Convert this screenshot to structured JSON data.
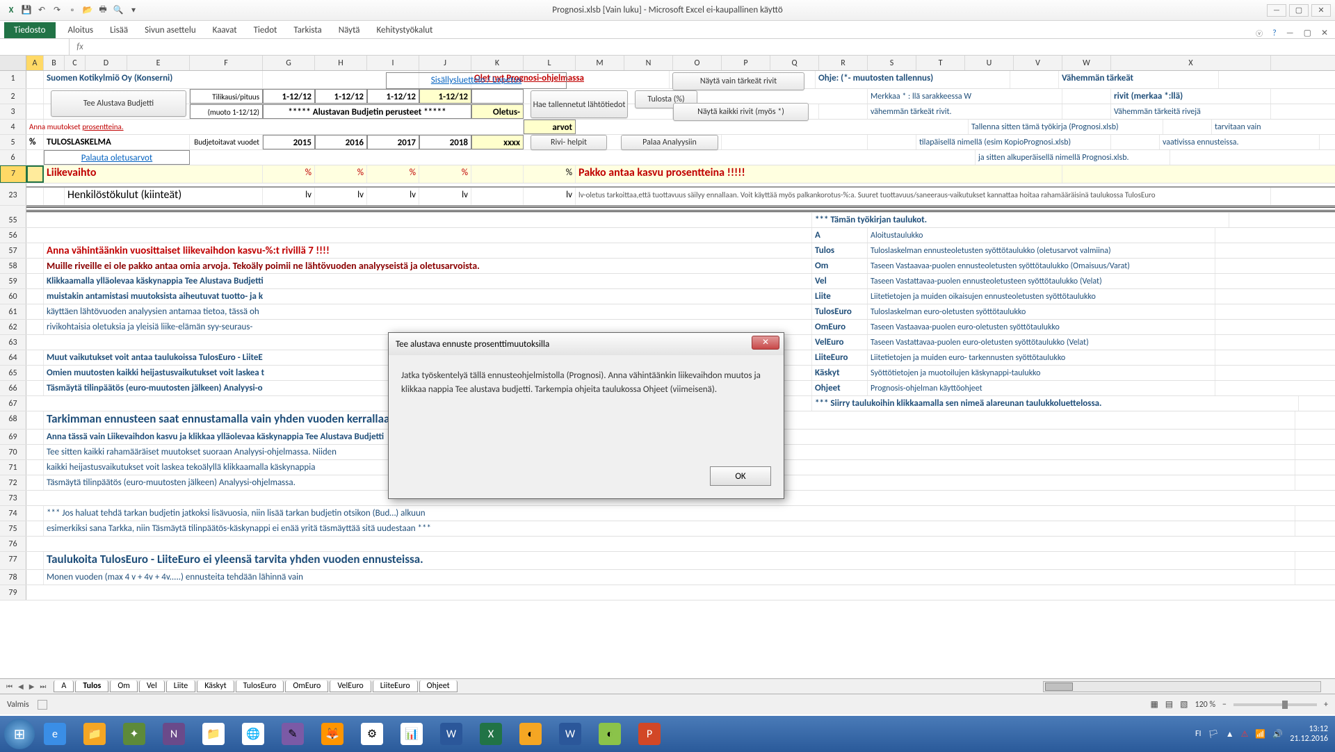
{
  "title": "Prognosi.xlsb  [Vain luku] - Microsoft Excel ei-kaupallinen käyttö",
  "ribbon": {
    "file": "Tiedosto",
    "tabs": [
      "Aloitus",
      "Lisää",
      "Sivun asettelu",
      "Kaavat",
      "Tiedot",
      "Tarkista",
      "Näytä",
      "Kehitystyökalut"
    ]
  },
  "columns": [
    "A",
    "B",
    "C",
    "D",
    "E",
    "F",
    "G",
    "H",
    "I",
    "J",
    "K",
    "L",
    "M",
    "N",
    "O",
    "P",
    "Q",
    "R",
    "S",
    "T",
    "U",
    "V",
    "W",
    "X"
  ],
  "rows_visible": [
    "1",
    "2",
    "3",
    "4",
    "5",
    "6",
    "7",
    "23",
    "55",
    "56",
    "57",
    "58",
    "59",
    "60",
    "61",
    "62",
    "63",
    "64",
    "65",
    "66",
    "67",
    "68",
    "69",
    "70",
    "71",
    "72",
    "73",
    "74",
    "75",
    "76",
    "77",
    "78",
    "79"
  ],
  "content": {
    "r1_company": "Suomen Kotikylmiö Oy (Konserni)",
    "r1_link": "Sisällysluettelo / Lopetus",
    "r1_red": "Olet nyt Prognosi-ohjelmassa",
    "btn_tarkeat": "Näytä vain tärkeät rivit",
    "r1_ohje": "Ohje: (*- muutosten tallennus)",
    "r1_vah": "Vähemmän tärkeät",
    "btn_tee": "Tee Alustava Budjetti",
    "r2_f": "Tilikausi/pituus",
    "r2_dates": [
      "1-12/12",
      "1-12/12",
      "1-12/12",
      "1-12/12"
    ],
    "btn_hae": "Hae tallennetut lähtötiedot",
    "btn_tulosta": "Tulosta (%)",
    "r2_s": "Merkkaa * : llä sarakkeessa W",
    "r2_x": "rivit (merkaa *:llä)",
    "r3_f": "(muoto 1-12/12)",
    "r3_g": "***** Alustavan Budjetin perusteet *****",
    "r3_k": "Oletus-",
    "btn_kaikki": "Näytä kaikki rivit (myös *)",
    "r3_s": "vähemmän tärkeät rivit.",
    "r3_x": "Vähemmän tärkeitä rivejä",
    "r4_a": "Anna muutokset ",
    "r4_a2": "prosentteina.",
    "r4_k": "arvot",
    "r4_s": "Tallenna sitten tämä työkirja (Prognosi.xlsb)",
    "r4_x": "tarvitaan vain",
    "r5_a": "%",
    "r5_b": "TULOSLASKELMA",
    "r5_f": "Budjetoitavat vuodet",
    "r5_years": [
      "2015",
      "2016",
      "2017",
      "2018"
    ],
    "r5_k": "xxxx",
    "btn_rivi": "Rivi- helpit",
    "btn_palaa": "Palaa Analyysiin",
    "r5_s": "tilapäisellä nimellä (esim KopioPrognosi.xlsb)",
    "r5_x": "vaativissa ennusteissa.",
    "r6_link": "Palauta oletusarvot",
    "r6_s": "ja sitten alkuperäisellä nimellä Prognosi.xlsb.",
    "r7_b": "Liikevaihto",
    "r7_pct": "%",
    "r7_l": "% ",
    "r7_red": "Pakko antaa kasvu prosentteina !!!!!",
    "r23_b": "Henkilöstökulut (kiinteät)",
    "r23_lv": "lv",
    "r23_note": "lv-oletus tarkoittaa,että tuottavuus säilyy ennallaan. Voit käyttää myös palkankorotus-%:a. Suuret tuottavuus/saneeraus-vaikutukset kannattaa hoitaa rahamääräisinä taulukossa TulosEuro",
    "r55_p": "*** Tämän työkirjan taulukot.",
    "r56_p": "A",
    "r56_r": "Aloitustaulukko",
    "r57_a": "Anna vähintäänkin vuosittaiset liikevaihdon kasvu-%:t rivillä 7 !!!!",
    "r57_p": "Tulos",
    "r57_r": "Tuloslaskelman ennusteoletusten syöttötaulukko (oletusarvot valmiina)",
    "r58_a": "Muille riveille ei ole pakko antaa omia arvoja. Tekoäly poimii ne lähtövuoden analyyseistä ja oletusarvoista.",
    "r58_p": "Om",
    "r58_r": "Taseen Vastaavaa-puolen ennusteoletusten syöttötaulukko (Omaisuus/Varat)",
    "r59_a": "Klikkaamalla ylläolevaa käskynappia Tee Alustava Budjetti",
    "r59_p": "Vel",
    "r59_r": "Taseen Vastattavaa-puolen ennusteoletusteen syöttötaulukko (Velat)",
    "r60_a": "muistakin antamistasi muutoksista aiheutuvat tuotto- ja k",
    "r60_p": "Liite",
    "r60_r": "Liitetietojen ja muiden oikaisujen ennusteoletusten syöttötaulukko",
    "r61_a": "käyttäen lähtövuoden analyysien antamaa tietoa, tässä oh",
    "r61_p": "TulosEuro",
    "r61_r": "Tuloslaskelman euro-oletusten syöttötaulukko",
    "r62_a": "rivikohtaisia oletuksia ja yleisiä liike-elämän syy-seuraus-",
    "r62_p": "OmEuro",
    "r62_r": "Taseen Vastaavaa-puolen euro-oletusten syöttötaulukko",
    "r63_p": "VelEuro",
    "r63_r": "Taseen Vastattavaa-puolen euro-oletusten syöttötaulukko (Velat)",
    "r64_a": "Muut vaikutukset voit antaa taulukoissa TulosEuro - LiiteE",
    "r64_p": "LiiteEuro",
    "r64_r": "Liitetietojen ja muiden euro- tarkennusten syöttötaulukko",
    "r65_a": "Omien muutosten kaikki heijastusvaikutukset voit laskea t",
    "r65_p": "Käskyt",
    "r65_r": "Syöttötietojen ja muotoilujen käskynappi-taulukko",
    "r66_a": "Täsmäytä tilinpäätös (euro-muutosten jälkeen) Analyysi-o",
    "r66_p": "Ohjeet",
    "r66_r": "Prognosis-ohjelman käyttöohjeet",
    "r67_p": "*** Siirry taulukoihin klikkaamalla sen nimeä alareunan taulukkoluettelossa.",
    "r68_a": "Tarkimman ennusteen saat ennustamalla vain yhden vuoden kerrallaan.",
    "r69_a": "Anna tässä vain Liikevaihdon kasvu ja klikkaa ylläolevaa käskynappia Tee Alustava Budjetti",
    "r70_a": "Tee sitten kaikki rahamääräiset muutokset suoraan Analyysi-ohjelmassa. Niiden",
    "r71_a": "kaikki heijastusvaikutukset voit laskea tekoälyllä klikkaamalla käskynappia",
    "r72_a": "Täsmäytä tilinpäätös (euro-muutosten jälkeen) Analyysi-ohjelmassa.",
    "r74_a": "*** Jos haluat tehdä tarkan budjetin jatkoksi lisävuosia, niin lisää tarkan budjetin otsikon (Bud…) alkuun",
    "r75_a": "esimerkiksi sana Tarkka, niin Täsmäytä tilinpäätös-käskynappi ei enää yritä täsmäyttää sitä uudestaan ***",
    "r77_a": "Taulukoita TulosEuro - LiiteEuro ei yleensä tarvita yhden vuoden ennusteissa.",
    "r78_a": "Monen vuoden (max 4 v + 4v + 4v.....)  ennusteita tehdään lähinnä vain"
  },
  "dialog": {
    "title": "Tee alustava ennuste prosenttimuutoksilla",
    "body": "Jatka työskentelyä tällä ennusteohjelmistolla (Prognosi). Anna vähintäänkin liikevaihdon muutos ja klikkaa nappia Tee alustava budjetti. Tarkempia ohjeita taulukossa Ohjeet (viimeisenä).",
    "ok": "OK"
  },
  "sheets": [
    "A",
    "Tulos",
    "Om",
    "Vel",
    "Liite",
    "Käskyt",
    "TulosEuro",
    "OmEuro",
    "VelEuro",
    "LiiteEuro",
    "Ohjeet"
  ],
  "active_sheet": "Tulos",
  "status": {
    "ready": "Valmis",
    "zoom": "120 %"
  },
  "tray": {
    "lang": "FI",
    "time": "13:12",
    "date": "21.12.2016"
  }
}
